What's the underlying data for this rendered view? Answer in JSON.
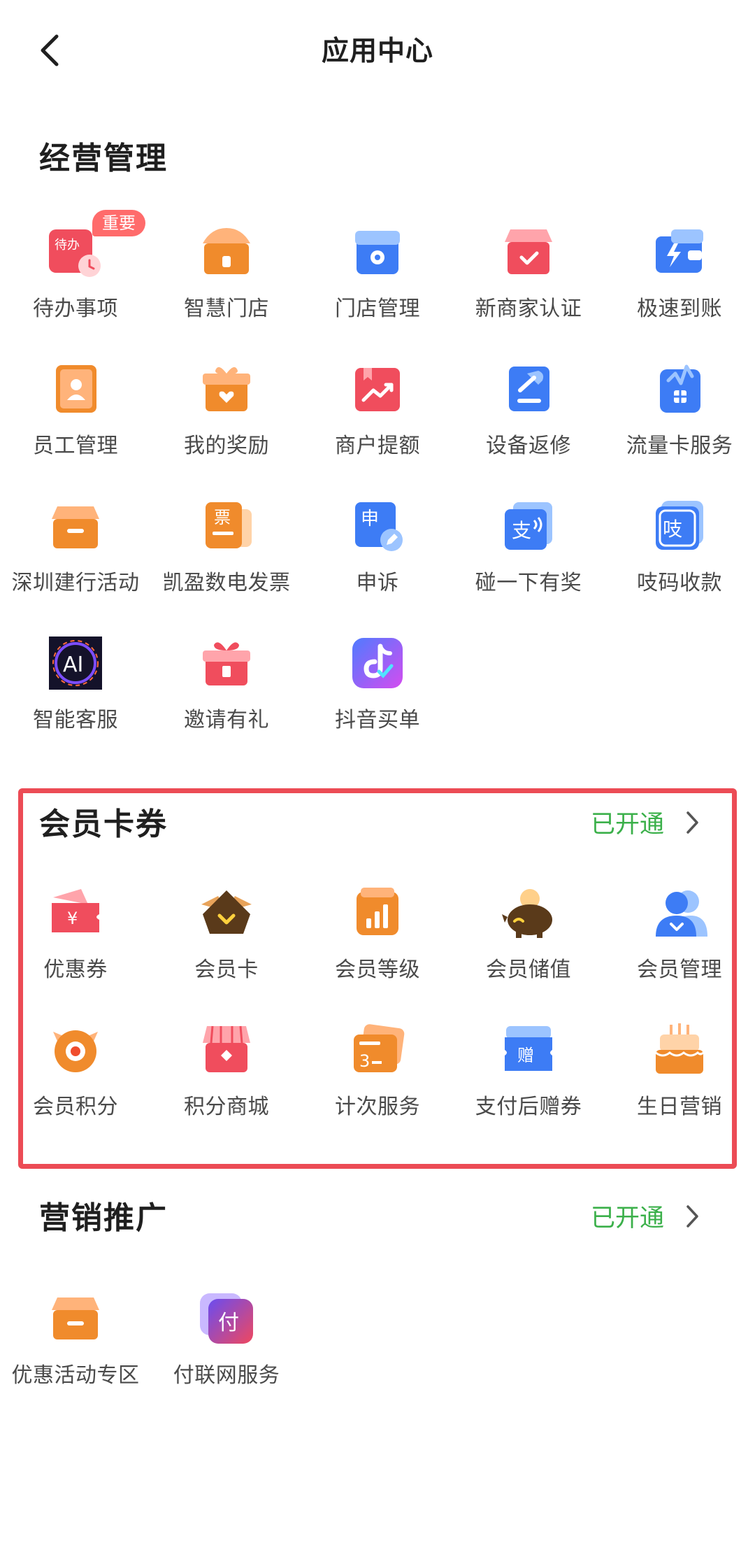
{
  "header": {
    "title": "应用中心"
  },
  "sections": {
    "business": {
      "title": "经营管理",
      "badge": "重要",
      "items": [
        {
          "label": "待办事项",
          "icon": "todo-icon"
        },
        {
          "label": "智慧门店",
          "icon": "smart-store-icon"
        },
        {
          "label": "门店管理",
          "icon": "store-manage-icon"
        },
        {
          "label": "新商家认证",
          "icon": "merchant-verify-icon"
        },
        {
          "label": "极速到账",
          "icon": "fast-arrival-icon"
        },
        {
          "label": "员工管理",
          "icon": "staff-icon"
        },
        {
          "label": "我的奖励",
          "icon": "reward-icon"
        },
        {
          "label": "商户提额",
          "icon": "quota-up-icon"
        },
        {
          "label": "设备返修",
          "icon": "repair-icon"
        },
        {
          "label": "流量卡服务",
          "icon": "data-card-icon"
        },
        {
          "label": "深圳建行活动",
          "icon": "bank-activity-icon"
        },
        {
          "label": "凯盈数电发票",
          "icon": "invoice-icon"
        },
        {
          "label": "申诉",
          "icon": "appeal-icon"
        },
        {
          "label": "碰一下有奖",
          "icon": "tap-reward-icon"
        },
        {
          "label": "吱码收款",
          "icon": "zhi-code-icon"
        },
        {
          "label": "智能客服",
          "icon": "ai-service-icon"
        },
        {
          "label": "邀请有礼",
          "icon": "invite-gift-icon"
        },
        {
          "label": "抖音买单",
          "icon": "douyin-pay-icon"
        }
      ]
    },
    "member": {
      "title": "会员卡券",
      "status": "已开通",
      "items": [
        {
          "label": "优惠券",
          "icon": "coupon-icon"
        },
        {
          "label": "会员卡",
          "icon": "member-card-icon"
        },
        {
          "label": "会员等级",
          "icon": "member-level-icon"
        },
        {
          "label": "会员储值",
          "icon": "member-deposit-icon"
        },
        {
          "label": "会员管理",
          "icon": "member-manage-icon"
        },
        {
          "label": "会员积分",
          "icon": "member-points-icon"
        },
        {
          "label": "积分商城",
          "icon": "points-mall-icon"
        },
        {
          "label": "计次服务",
          "icon": "count-service-icon"
        },
        {
          "label": "支付后赠券",
          "icon": "post-pay-coupon-icon"
        },
        {
          "label": "生日营销",
          "icon": "birthday-icon"
        }
      ]
    },
    "marketing": {
      "title": "营销推广",
      "status": "已开通",
      "items": [
        {
          "label": "优惠活动专区",
          "icon": "promo-zone-icon"
        },
        {
          "label": "付联网服务",
          "icon": "fulian-service-icon"
        }
      ]
    }
  },
  "glyphs": {
    "todo": "待办",
    "coupon": "¥",
    "count": "3",
    "gift_coupon": "赠",
    "invoice": "票",
    "appeal": "申",
    "tap": "支",
    "zhi": "吱",
    "ai": "AI",
    "fulian": "付"
  },
  "colors": {
    "accent_green": "#3bb04a",
    "highlight_red": "#ec4b55"
  }
}
